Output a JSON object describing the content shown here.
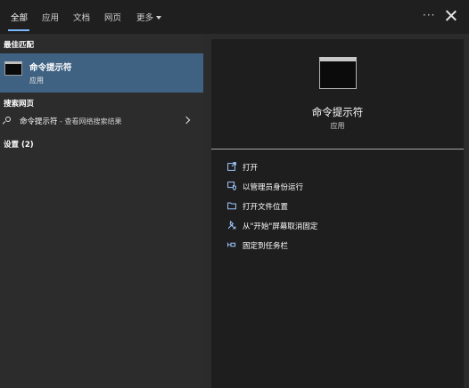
{
  "tabs": [
    {
      "label": "全部",
      "active": true
    },
    {
      "label": "应用",
      "active": false
    },
    {
      "label": "文档",
      "active": false
    },
    {
      "label": "网页",
      "active": false
    },
    {
      "label": "更多",
      "active": false
    }
  ],
  "more_options": "···",
  "sections": {
    "best_match": "最佳匹配",
    "search_web": "搜索网页",
    "settings": "设置 (2)"
  },
  "best_match": {
    "title": "命令提示符",
    "subtitle": "应用",
    "icon": "terminal-icon"
  },
  "web_result": {
    "query": "命令提示符",
    "suffix": " - 查看网络搜索结果",
    "icon": "search-icon"
  },
  "detail": {
    "title": "命令提示符",
    "subtitle": "应用",
    "icon": "terminal-icon"
  },
  "actions": [
    {
      "label": "打开",
      "icon": "open-icon"
    },
    {
      "label": "以管理员身份运行",
      "icon": "shield-admin-icon"
    },
    {
      "label": "打开文件位置",
      "icon": "folder-icon"
    },
    {
      "label": "从\"开始\"屏幕取消固定",
      "icon": "unpin-icon"
    },
    {
      "label": "固定到任务栏",
      "icon": "pin-taskbar-icon"
    }
  ],
  "colors": {
    "accent": "#7ab8ff",
    "selected_bg": "#3f6283",
    "panel_bg": "#1e1e1e"
  }
}
